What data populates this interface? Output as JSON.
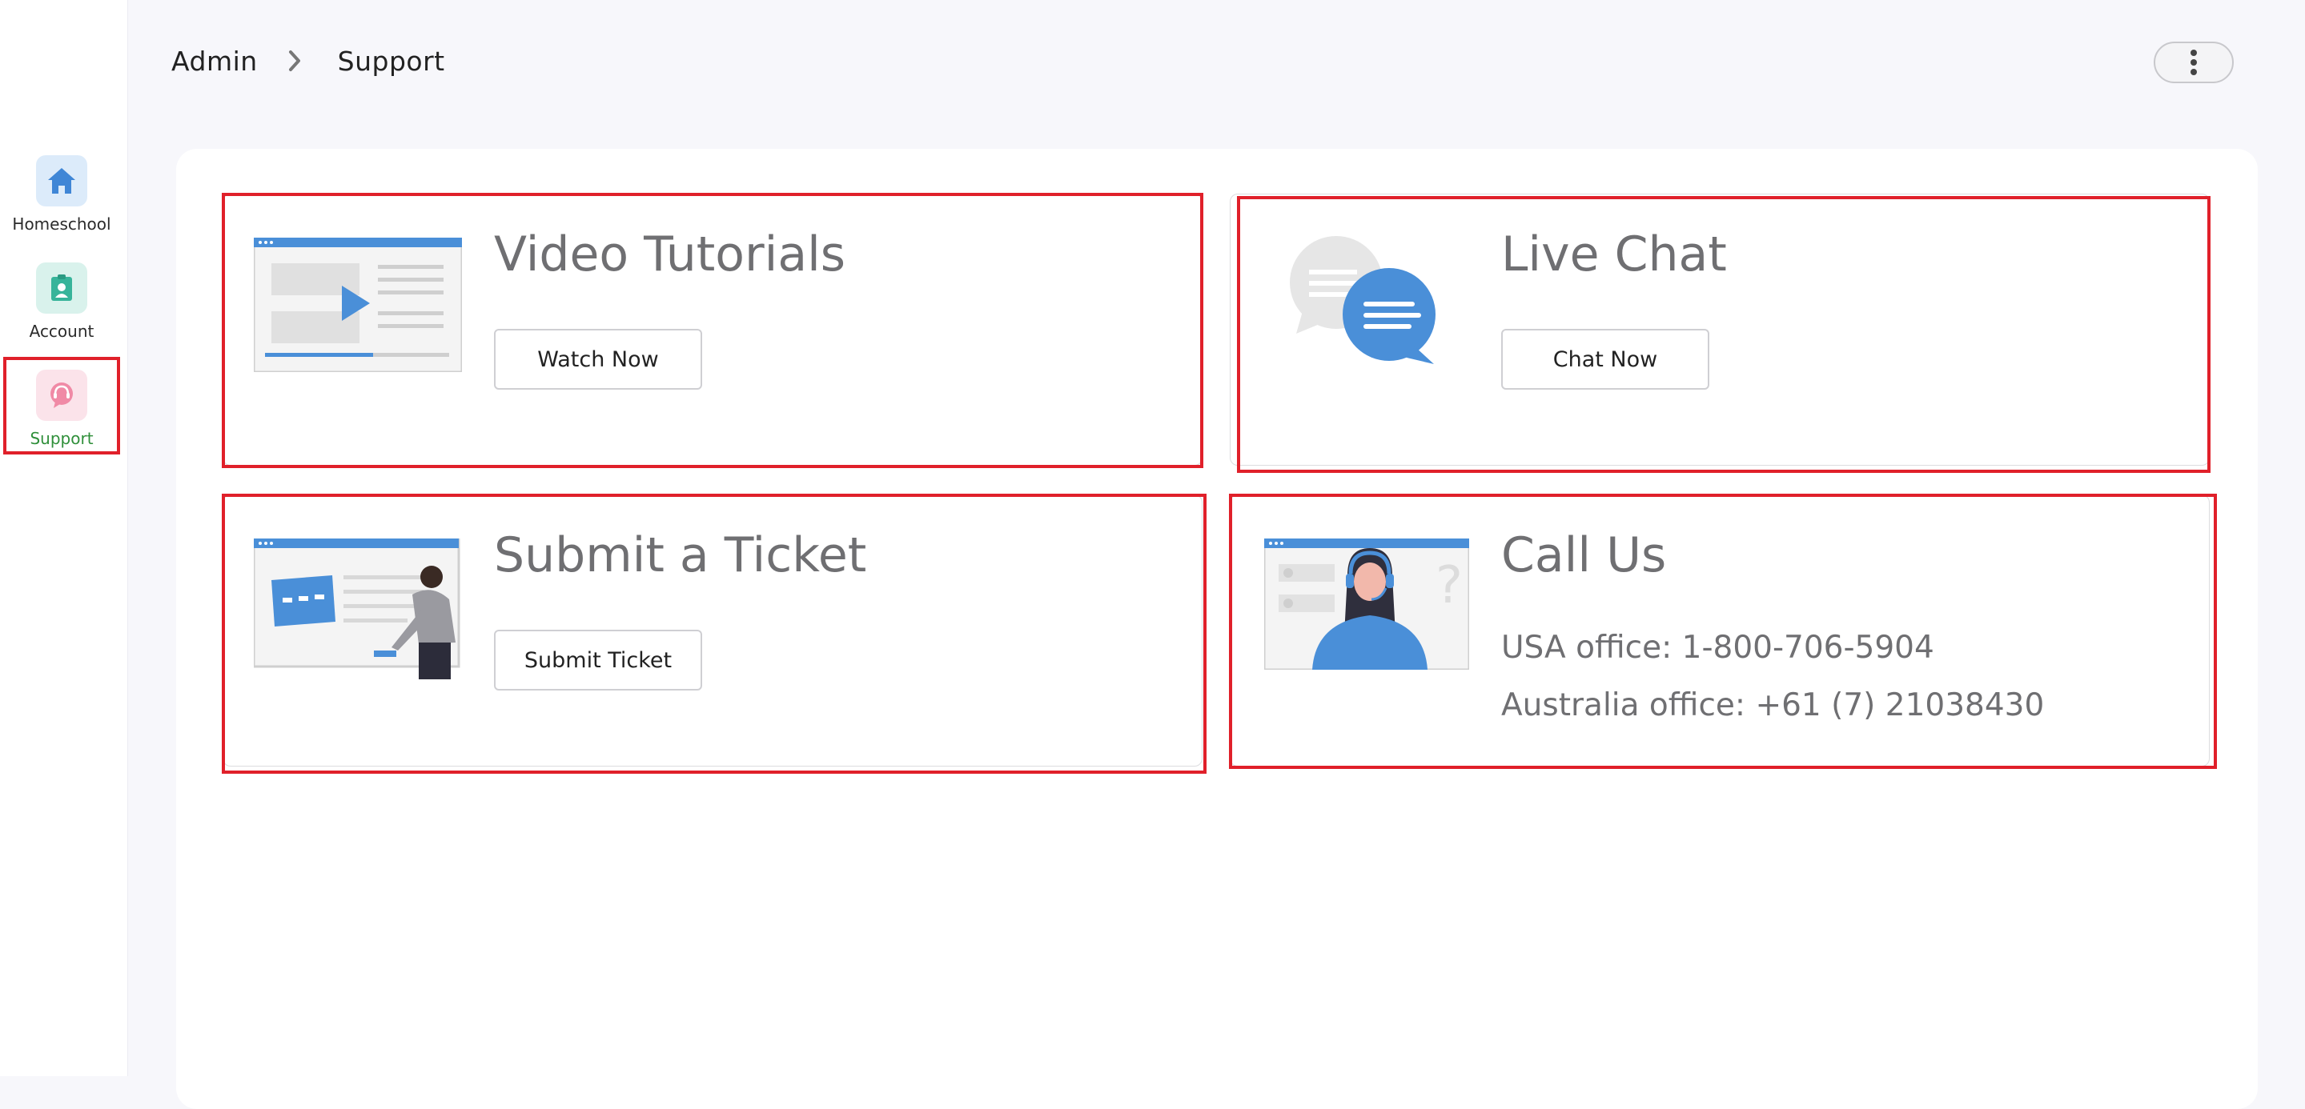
{
  "sidebar": {
    "items": [
      {
        "label": "Homeschool",
        "icon": "home-icon"
      },
      {
        "label": "Account",
        "icon": "badge-icon"
      },
      {
        "label": "Support",
        "icon": "support-icon",
        "active": true
      }
    ]
  },
  "header": {
    "breadcrumb": [
      "Admin",
      "Support"
    ],
    "menu_icon": "kebab-menu-icon"
  },
  "cards": {
    "video": {
      "title": "Video Tutorials",
      "button": "Watch Now"
    },
    "chat": {
      "title": "Live Chat",
      "button": "Chat Now"
    },
    "ticket": {
      "title": "Submit a Ticket",
      "button": "Submit Ticket"
    },
    "call": {
      "title": "Call Us",
      "usa": "USA office: 1-800-706-5904",
      "australia": "Australia office: +61 (7) 21038430"
    }
  },
  "colors": {
    "accent_blue": "#4a8fd8",
    "highlight_red": "#e0202a",
    "active_green": "#2f8f3a"
  }
}
